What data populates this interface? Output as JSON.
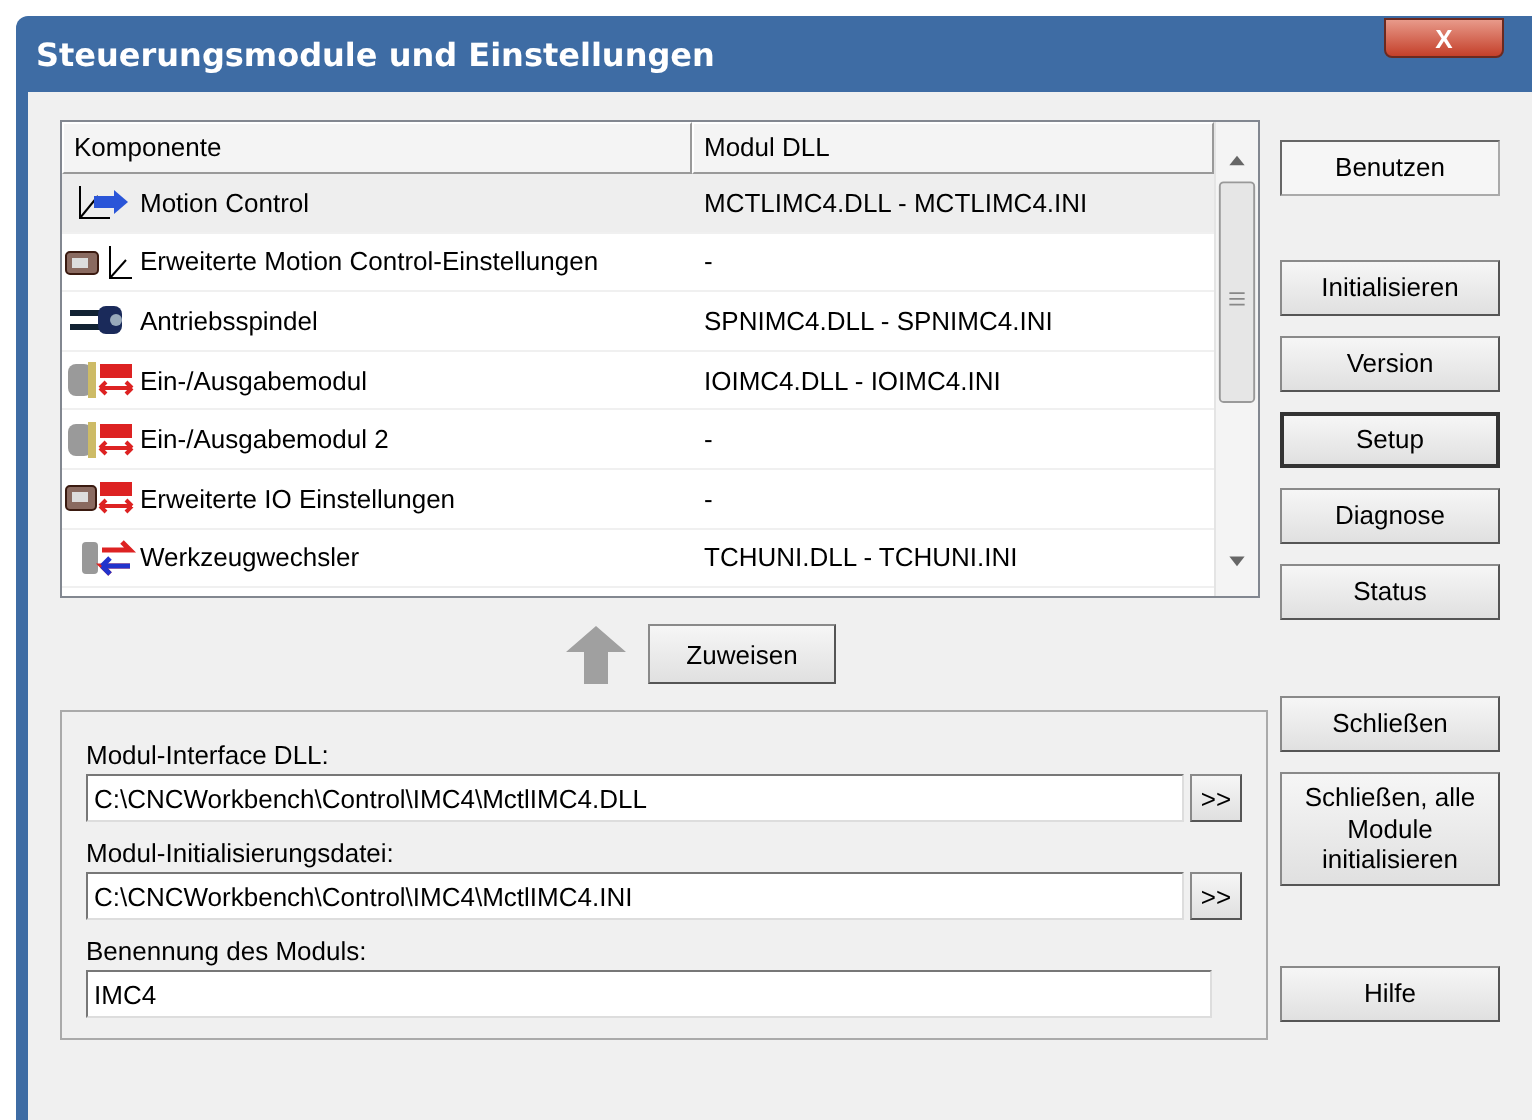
{
  "window": {
    "title": "Steuerungsmodule und Einstellungen",
    "close_label": "X"
  },
  "table": {
    "columns": [
      "Komponente",
      "Modul DLL"
    ],
    "rows": [
      {
        "kind": "axes",
        "component": "Motion Control",
        "module": "MCTLIMC4.DLL - MCTLIMC4.INI",
        "selected": true
      },
      {
        "kind": "card-axes",
        "component": "Erweiterte Motion Control-Einstellungen",
        "module": "-",
        "selected": false
      },
      {
        "kind": "spindle",
        "component": "Antriebsspindel",
        "module": "SPNIMC4.DLL - SPNIMC4.INI",
        "selected": false
      },
      {
        "kind": "io",
        "component": "Ein-/Ausgabemodul",
        "module": "IOIMC4.DLL - IOIMC4.INI",
        "selected": false
      },
      {
        "kind": "io",
        "component": "Ein-/Ausgabemodul 2",
        "module": "-",
        "selected": false
      },
      {
        "kind": "card-io",
        "component": "Erweiterte IO Einstellungen",
        "module": "-",
        "selected": false
      },
      {
        "kind": "toolchanger",
        "component": "Werkzeugwechsler",
        "module": "TCHUNI.DLL - TCHUNI.INI",
        "selected": false
      }
    ]
  },
  "assign_button": "Zuweisen",
  "fields": [
    {
      "label": "Modul-Interface DLL:",
      "value": "C:\\CNCWorkbench\\Control\\IMC4\\MctlIMC4.DLL",
      "browse": ">>"
    },
    {
      "label": "Modul-Initialisierungsdatei:",
      "value": "C:\\CNCWorkbench\\Control\\IMC4\\MctlIMC4.INI",
      "browse": ">>"
    },
    {
      "label": "Benennung des Moduls:",
      "value": "IMC4"
    }
  ],
  "buttons": [
    {
      "label": "Benutzen",
      "pressed": true,
      "focused": false
    },
    {
      "label": "Initialisieren",
      "pressed": false,
      "focused": false
    },
    {
      "label": "Version",
      "pressed": false,
      "focused": false
    },
    {
      "label": "Setup",
      "pressed": false,
      "focused": true
    },
    {
      "label": "Diagnose",
      "pressed": false,
      "focused": false
    },
    {
      "label": "Status",
      "pressed": false,
      "focused": false
    },
    {
      "label": "Schließen",
      "pressed": false,
      "focused": false
    },
    {
      "label": "Schließen, alle Module initialisieren",
      "pressed": false,
      "focused": false
    },
    {
      "label": "Hilfe",
      "pressed": false,
      "focused": false
    }
  ]
}
